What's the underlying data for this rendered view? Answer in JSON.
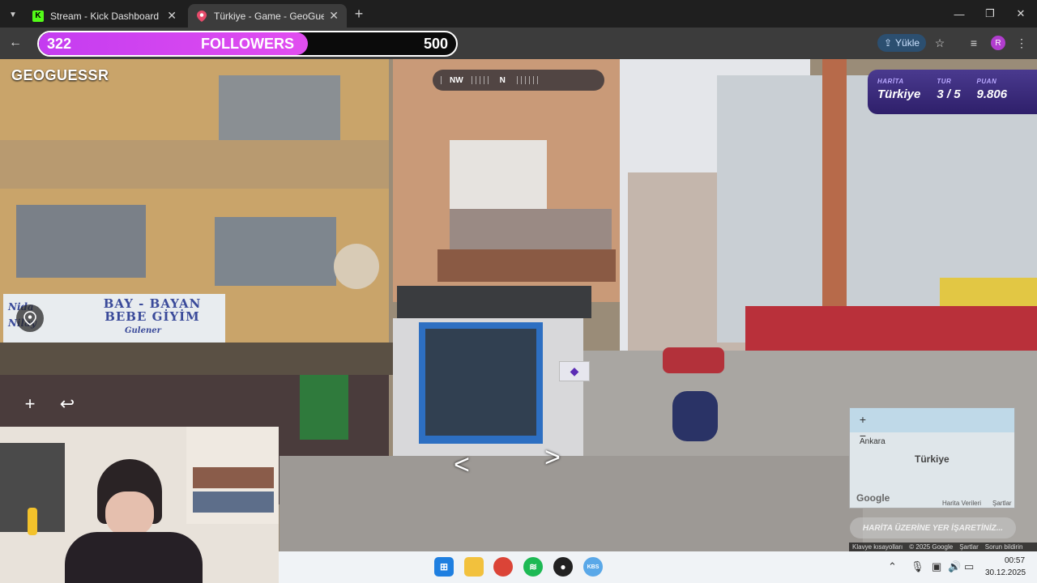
{
  "browser": {
    "tabs": [
      {
        "label": "Stream - Kick Dashboard",
        "icon": "kick-icon",
        "active": false
      },
      {
        "label": "Türkiye - Game - GeoGuessr",
        "icon": "location-pin-icon",
        "active": true
      }
    ],
    "toolbar": {
      "upload_label": "Yükle",
      "profile_initial": "R"
    }
  },
  "follower_goal": {
    "current": "322",
    "label": "FOLLOWERS",
    "goal": "500",
    "progress_fraction": 0.644,
    "accent": "#d444f1"
  },
  "geoguessr": {
    "logo": "GEOGUESSR",
    "compass": {
      "left": "NW",
      "center": "N"
    },
    "info": [
      {
        "label": "HARİTA",
        "value": "Türkiye"
      },
      {
        "label": "TUR",
        "value": "3 / 5"
      },
      {
        "label": "PUAN",
        "value": "9.806"
      }
    ],
    "minimap": {
      "country": "Türkiye",
      "city": "Ankara",
      "google": "Google",
      "map_data": "Harita Verileri",
      "terms": "Şartlar"
    },
    "guess_button": "HARİTA ÜZERİNE YER İŞARETİNİZ..."
  },
  "google_footer": [
    "Klavye kısayolları",
    "© 2025 Google",
    "Şartlar",
    "Sorun bildirin"
  ],
  "street_sign": {
    "line1": "BAY - BAYAN",
    "line2": "BEBE GİYİM",
    "left_top": "Nida",
    "left_bottom": "Nilay",
    "sub": "Gulener"
  },
  "taskbar": {
    "time": "00:57",
    "date": "30.12.2025"
  },
  "colors": {
    "panel": "#3b2c80",
    "accent_purple": "#c43cf0",
    "kick_green": "#53fc18"
  }
}
